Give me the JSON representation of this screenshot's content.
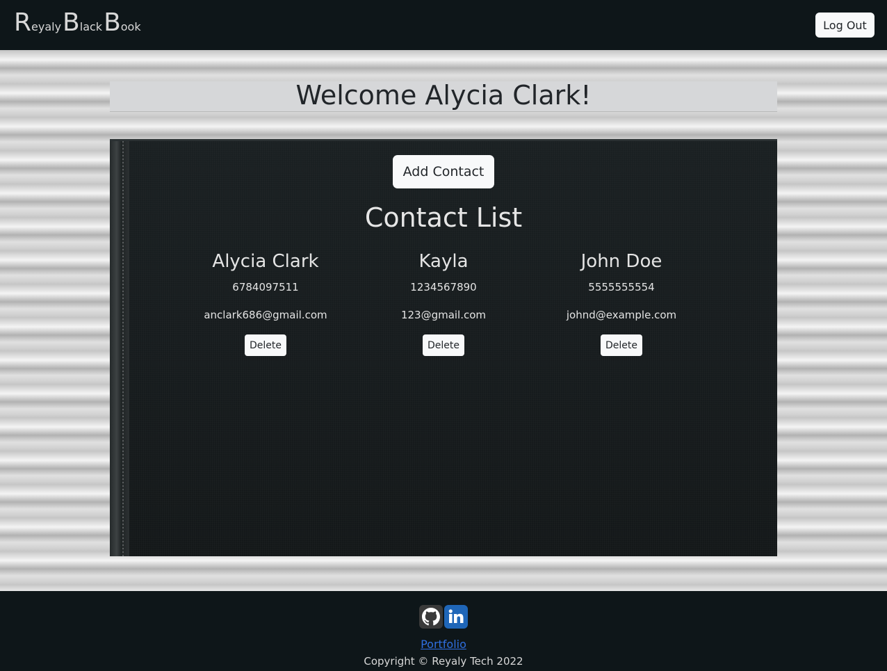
{
  "header": {
    "brand_parts": [
      {
        "cap": "R",
        "rest": "eyaly"
      },
      {
        "cap": "B",
        "rest": "lack"
      },
      {
        "cap": "B",
        "rest": "ook"
      }
    ],
    "logout_label": "Log Out"
  },
  "welcome": {
    "title": "Welcome Alycia Clark!"
  },
  "book": {
    "add_label": "Add Contact",
    "list_title": "Contact List",
    "contacts": [
      {
        "name": "Alycia Clark",
        "phone": "6784097511",
        "email": "anclark686@gmail.com",
        "delete_label": "Delete"
      },
      {
        "name": "Kayla",
        "phone": "1234567890",
        "email": "123@gmail.com",
        "delete_label": "Delete"
      },
      {
        "name": "John Doe",
        "phone": "5555555554",
        "email": "johnd@example.com",
        "delete_label": "Delete"
      }
    ]
  },
  "footer": {
    "icons": [
      "github-icon",
      "linkedin-icon"
    ],
    "portfolio_label": "Portfolio",
    "copyright": "Copyright © Reyaly Tech 2022"
  },
  "colors": {
    "nav_bg": "#0e1619",
    "book_bg": "#171c1e",
    "link": "#2f6fe0",
    "linkedin": "#1f66b8"
  }
}
